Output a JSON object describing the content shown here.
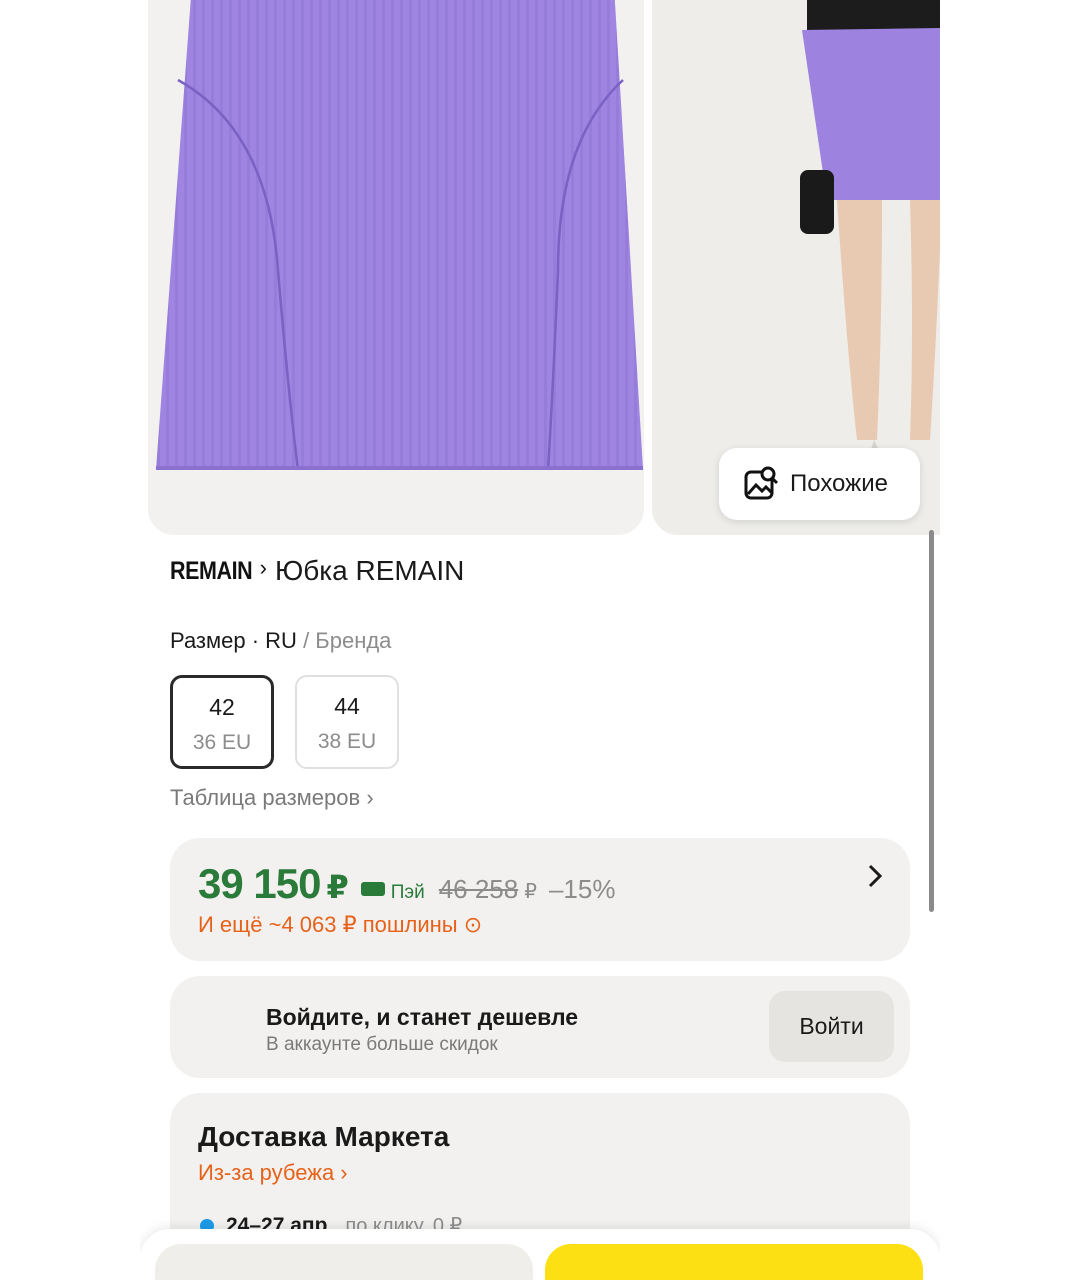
{
  "gallery": {
    "similar_label": "Похожие"
  },
  "product": {
    "brand_logo": "REMAIN",
    "title": "Юбка REMAIN"
  },
  "size": {
    "label_prefix": "Размер · RU",
    "label_suffix": " / Бренда",
    "options": [
      {
        "main": "42",
        "sub": "36 EU",
        "selected": true
      },
      {
        "main": "44",
        "sub": "38 EU",
        "selected": false
      }
    ],
    "table_link": "Таблица размеров ›"
  },
  "price": {
    "current": "39 150",
    "currency": "₽",
    "pay_label": "Пэй",
    "old": "46 258",
    "old_currency": "₽",
    "discount": "–15%",
    "duty_text": "И ещё ~4 063 ₽ пошлины ⊙"
  },
  "login": {
    "title": "Войдите, и станет дешевле",
    "subtitle": "В аккаунте больше скидок",
    "button": "Войти"
  },
  "delivery": {
    "title": "Доставка Маркета",
    "origin_link": "Из-за рубежа ›",
    "date": "24–27 апр",
    "note": "по клику, 0 ₽"
  },
  "colors": {
    "price_green": "#2a7a3a",
    "accent_orange": "#e6621a",
    "cta_yellow": "#fde014",
    "skirt_lilac": "#9d82e0"
  }
}
